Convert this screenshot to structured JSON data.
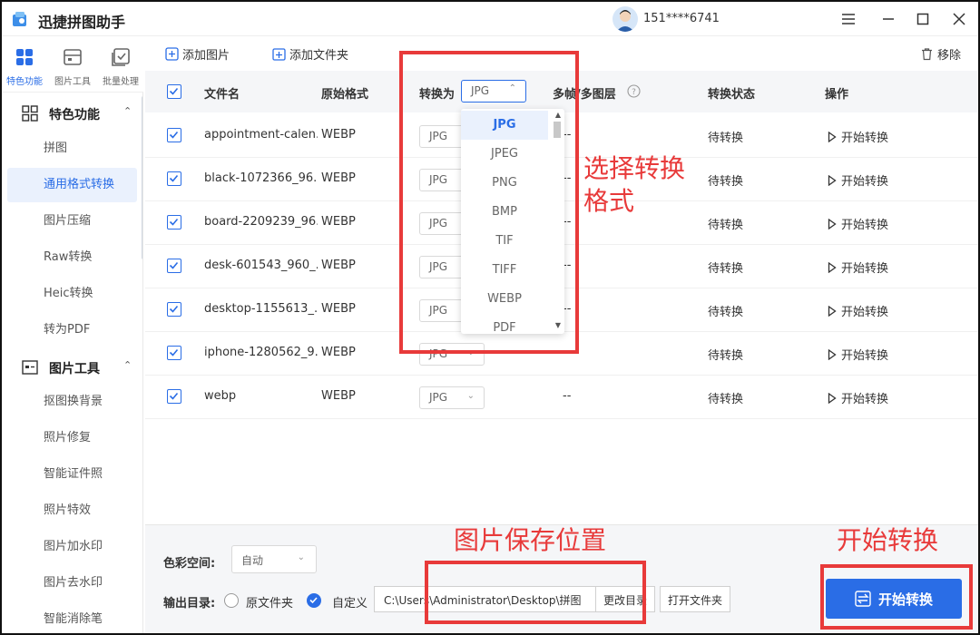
{
  "app": {
    "title": "迅捷拼图助手",
    "user_phone": "151****6741"
  },
  "rail": [
    {
      "label": "特色功能",
      "icon": "grid-icon"
    },
    {
      "label": "图片工具",
      "icon": "image-tools-icon"
    },
    {
      "label": "批量处理",
      "icon": "batch-icon"
    }
  ],
  "sidebar": {
    "sections": [
      {
        "label": "特色功能",
        "items": [
          "拼图",
          "通用格式转换",
          "图片压缩",
          "Raw转换",
          "Heic转换",
          "转为PDF"
        ]
      },
      {
        "label": "图片工具",
        "items": [
          "抠图换背景",
          "照片修复",
          "智能证件照",
          "照片特效",
          "图片加水印",
          "图片去水印",
          "智能消除笔"
        ]
      }
    ],
    "active_item": "通用格式转换"
  },
  "toolbar": {
    "add_image": "添加图片",
    "add_folder": "添加文件夹",
    "remove": "移除"
  },
  "table": {
    "headers": {
      "filename": "文件名",
      "orig_format": "原始格式",
      "convert_to": "转换为",
      "convert_to_value": "JPG",
      "multiframe": "多帧/多图层",
      "status": "转换状态",
      "action": "操作"
    },
    "rows": [
      {
        "name": "appointment-calen...",
        "format": "WEBP",
        "target": "JPG",
        "multi": "--",
        "status": "待转换",
        "action": "开始转换"
      },
      {
        "name": "black-1072366_96...",
        "format": "WEBP",
        "target": "JPG",
        "multi": "--",
        "status": "待转换",
        "action": "开始转换"
      },
      {
        "name": "board-2209239_96...",
        "format": "WEBP",
        "target": "JPG",
        "multi": "--",
        "status": "待转换",
        "action": "开始转换"
      },
      {
        "name": "desk-601543_960_...",
        "format": "WEBP",
        "target": "JPG",
        "multi": "--",
        "status": "待转换",
        "action": "开始转换"
      },
      {
        "name": "desktop-1155613_...",
        "format": "WEBP",
        "target": "JPG",
        "multi": "--",
        "status": "待转换",
        "action": "开始转换"
      },
      {
        "name": "iphone-1280562_9...",
        "format": "WEBP",
        "target": "JPG",
        "multi": "--",
        "status": "待转换",
        "action": "开始转换"
      },
      {
        "name": "webp",
        "format": "WEBP",
        "target": "JPG",
        "multi": "--",
        "status": "待转换",
        "action": "开始转换"
      }
    ]
  },
  "dropdown": {
    "options": [
      "JPG",
      "JPEG",
      "PNG",
      "BMP",
      "TIF",
      "TIFF",
      "WEBP",
      "PDF"
    ],
    "selected": "JPG"
  },
  "bottom": {
    "color_space_label": "色彩空间:",
    "color_space_value": "自动",
    "output_label": "输出目录:",
    "radio_original": "原文件夹",
    "radio_custom": "自定义",
    "path": "C:\\Users\\Administrator\\Desktop\\拼图",
    "change_dir": "更改目录",
    "open_folder": "打开文件夹",
    "start_button": "开始转换"
  },
  "annotations": {
    "select_format": "选择转换\n格式",
    "save_location": "图片保存位置",
    "start_convert": "开始转换"
  },
  "colors": {
    "accent": "#2a6de6",
    "annotation_red": "#e83a3a"
  }
}
